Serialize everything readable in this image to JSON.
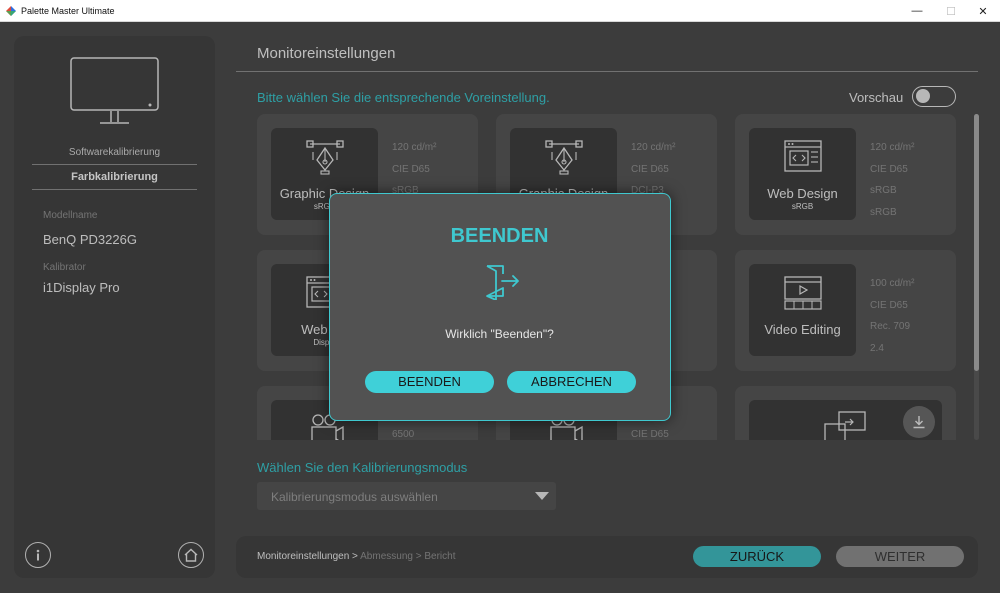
{
  "window": {
    "title": "Palette Master Ultimate",
    "minimize": "—",
    "maximize": "☐",
    "close": "✕"
  },
  "sidebar": {
    "links": [
      "Softwarekalibrierung",
      "Farbkalibrierung"
    ],
    "model_label": "Modellname",
    "model_value": "BenQ PD3226G",
    "calibrator_label": "Kalibrator",
    "calibrator_value": "i1Display Pro"
  },
  "main": {
    "title": "Monitoreinstellungen",
    "instruction": "Bitte wählen Sie die entsprechende Voreinstellung.",
    "preview_label": "Vorschau",
    "preview_enabled": false,
    "cards": [
      {
        "name": "Graphic Design",
        "sub": "sRGB",
        "icon": "pen-tool-icon",
        "specs": [
          "120 cd/m²",
          "CIE D65",
          "sRGB"
        ]
      },
      {
        "name": "Graphic Design",
        "sub": "",
        "icon": "pen-tool-icon",
        "specs": [
          "120 cd/m²",
          "CIE D65",
          "DCI-P3"
        ]
      },
      {
        "name": "Web Design",
        "sub": "sRGB",
        "icon": "web-code-icon",
        "specs": [
          "120 cd/m²",
          "CIE D65",
          "sRGB",
          "sRGB"
        ]
      },
      {
        "name": "Web De",
        "sub": "Displa",
        "icon": "web-code-icon",
        "specs": []
      },
      {
        "name": "",
        "sub": "",
        "icon": "",
        "specs": [
          "²"
        ]
      },
      {
        "name": "Video Editing",
        "sub": "",
        "icon": "video-editing-icon",
        "specs": [
          "100 cd/m²",
          "CIE D65",
          "Rec. 709",
          "2.4"
        ]
      },
      {
        "name": "",
        "sub": "",
        "icon": "film-camera-icon",
        "specs": [
          "6500"
        ]
      },
      {
        "name": "",
        "sub": "",
        "icon": "film-camera-icon",
        "specs": [
          "CIE D65"
        ]
      },
      {
        "name": "",
        "sub": "",
        "icon": "import-preset-icon",
        "specs": []
      }
    ],
    "mode_title": "Wählen Sie den Kalibrierungsmodus",
    "mode_placeholder": "Kalibrierungsmodus auswählen"
  },
  "footer": {
    "crumbs": [
      "Monitoreinstellungen >",
      "Abmessung >",
      "Bericht"
    ],
    "back_label": "ZURÜCK",
    "next_label": "WEITER"
  },
  "dialog": {
    "title": "BEENDEN",
    "message": "Wirklich \"Beenden\"?",
    "confirm_label": "BEENDEN",
    "cancel_label": "ABBRECHEN"
  },
  "colors": {
    "accent": "#3fc8cf",
    "background": "#4a4a4a",
    "panel": "#424242",
    "card": "#555555"
  }
}
